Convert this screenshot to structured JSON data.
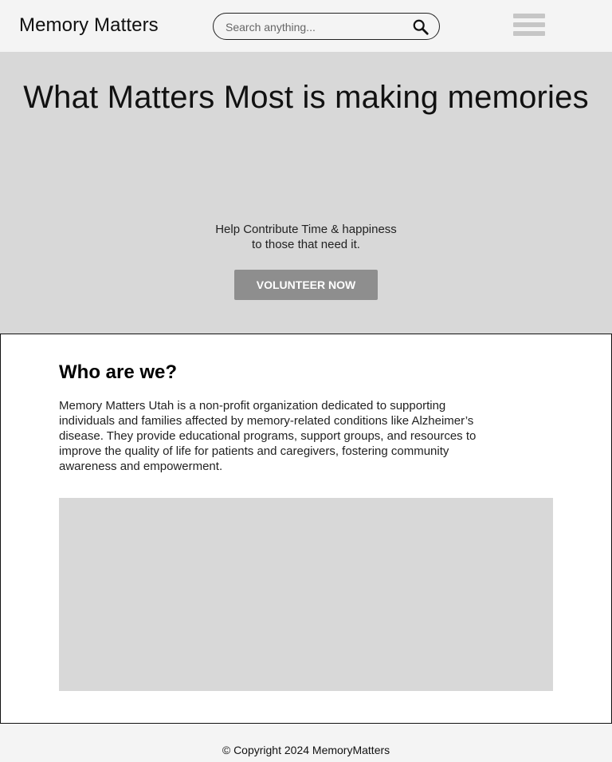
{
  "header": {
    "logo": "Memory Matters",
    "search": {
      "placeholder": "Search anything...",
      "icon": "search-icon"
    },
    "menu_icon": "hamburger-menu-icon"
  },
  "hero": {
    "title": "What Matters Most is making memories",
    "subtitle_line1": "Help Contribute Time & happiness",
    "subtitle_line2": "to those that need it.",
    "button_label": "VOLUNTEER NOW"
  },
  "about": {
    "heading": "Who are we?",
    "body": "Memory Matters Utah is a non-profit organization dedicated to supporting individuals and families affected by memory-related conditions like Alzheimer’s disease. They provide educational programs, support groups, and resources to improve the quality of life for patients and caregivers, fostering community awareness and empowerment."
  },
  "footer": {
    "copyright": "© Copyright 2024 MemoryMatters"
  },
  "colors": {
    "header_bg": "#f4f4f4",
    "hero_bg": "#d8d8d8",
    "button_bg": "#8e8e8e",
    "placeholder_image": "#d8d8d8"
  }
}
